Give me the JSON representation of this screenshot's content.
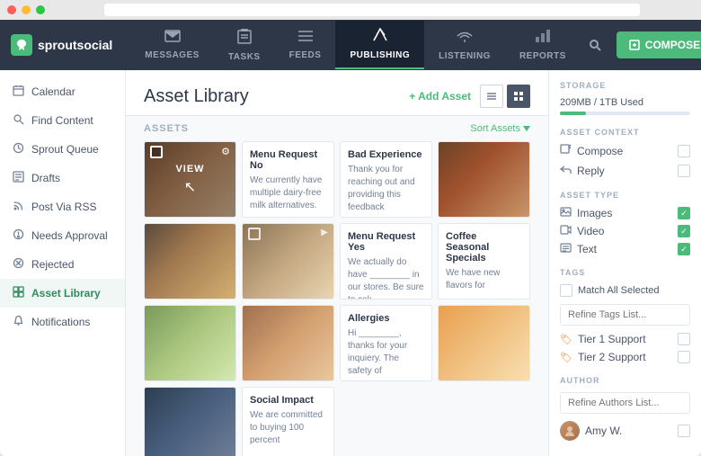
{
  "window": {
    "dots": [
      "red",
      "yellow",
      "green"
    ]
  },
  "nav": {
    "logo_text": "sproutsocial",
    "items": [
      {
        "id": "messages",
        "label": "MESSAGES",
        "icon": "✉",
        "active": false
      },
      {
        "id": "tasks",
        "label": "TASKS",
        "icon": "📌",
        "active": false
      },
      {
        "id": "feeds",
        "label": "FEEDS",
        "icon": "☰",
        "active": false
      },
      {
        "id": "publishing",
        "label": "PUBLISHING",
        "icon": "✈",
        "active": true
      },
      {
        "id": "listening",
        "label": "LISTENING",
        "icon": "🎧",
        "active": false
      },
      {
        "id": "reports",
        "label": "REPORTS",
        "icon": "📊",
        "active": false
      }
    ],
    "compose_label": "COMPOSE"
  },
  "sidebar": {
    "items": [
      {
        "id": "calendar",
        "label": "Calendar",
        "icon": "📅"
      },
      {
        "id": "find-content",
        "label": "Find Content",
        "icon": "🔍"
      },
      {
        "id": "sprout-queue",
        "label": "Sprout Queue",
        "icon": "🔄"
      },
      {
        "id": "drafts",
        "label": "Drafts",
        "icon": "📝"
      },
      {
        "id": "post-via-rss",
        "label": "Post Via RSS",
        "icon": "📡"
      },
      {
        "id": "needs-approval",
        "label": "Needs Approval",
        "icon": "⏰"
      },
      {
        "id": "rejected",
        "label": "Rejected",
        "icon": "🚫"
      },
      {
        "id": "asset-library",
        "label": "Asset Library",
        "icon": "🖼",
        "active": true
      },
      {
        "id": "notifications",
        "label": "Notifications",
        "icon": "🔔"
      }
    ]
  },
  "main": {
    "title": "Asset Library",
    "add_asset_label": "+ Add Asset",
    "assets_label": "ASSETS",
    "sort_label": "Sort Assets",
    "cards": [
      {
        "type": "image",
        "img_class": "img-coffee1",
        "has_overlay": true,
        "overlay_label": "VIEW"
      },
      {
        "type": "text",
        "title": "Menu Request No",
        "body": "We currently have multiple dairy-free milk alternatives."
      },
      {
        "type": "text",
        "title": "Bad Experience",
        "body": "Thank you for reaching out and providing this feedback"
      },
      {
        "type": "image",
        "img_class": "img-coffee2"
      },
      {
        "type": "image",
        "img_class": "img-food1"
      },
      {
        "type": "image",
        "img_class": "img-food2"
      },
      {
        "type": "text",
        "title": "Menu Request Yes",
        "body": "We actually do have ________ in our stores. Be sure to ask"
      },
      {
        "type": "text",
        "title": "Coffee Seasonal Specials",
        "body": "We have new flavors for"
      },
      {
        "type": "image",
        "img_class": "img-coffee3"
      },
      {
        "type": "image",
        "img_class": "img-coffee4"
      },
      {
        "type": "text",
        "title": "Allergies",
        "body": "Hi ________, thanks for your inquiery. The safety of"
      },
      {
        "type": "image",
        "img_class": "img-card-dark"
      },
      {
        "type": "image",
        "img_class": "img-tech"
      },
      {
        "type": "text",
        "title": "Social Impact",
        "body": "We are committed to buying 100 percent"
      }
    ]
  },
  "right_panel": {
    "storage_title": "STORAGE",
    "storage_text": "209MB / 1TB Used",
    "storage_pct": 20,
    "asset_context_title": "ASSET CONTEXT",
    "context_items": [
      {
        "id": "compose",
        "label": "Compose",
        "icon": "✏",
        "checked": false
      },
      {
        "id": "reply",
        "label": "Reply",
        "icon": "↩",
        "checked": false
      }
    ],
    "asset_type_title": "ASSET TYPE",
    "type_items": [
      {
        "id": "images",
        "label": "Images",
        "icon": "🖼",
        "checked": true
      },
      {
        "id": "video",
        "label": "Video",
        "icon": "🎬",
        "checked": true
      },
      {
        "id": "text",
        "label": "Text",
        "icon": "📄",
        "checked": true
      }
    ],
    "tags_title": "TAGS",
    "tags_match_label": "Match All Selected",
    "tags_input_placeholder": "Refine Tags List...",
    "tag_items": [
      {
        "id": "tier1",
        "label": "Tier 1 Support",
        "checked": false
      },
      {
        "id": "tier2",
        "label": "Tier 2 Support",
        "checked": false
      }
    ],
    "author_title": "AUTHOR",
    "author_input_placeholder": "Refine Authors List...",
    "authors": [
      {
        "id": "amy",
        "name": "Amy W.",
        "checked": false
      }
    ]
  }
}
